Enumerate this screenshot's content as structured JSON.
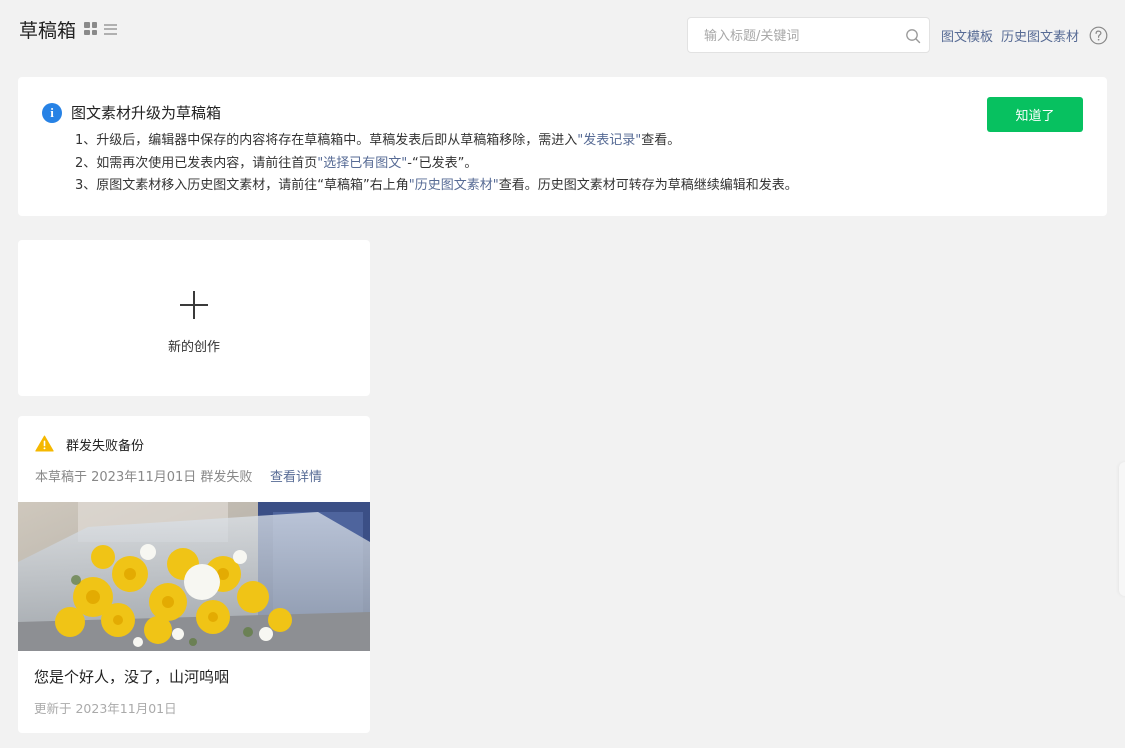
{
  "header": {
    "title": "草稿箱",
    "view_toggle": {
      "grid_icon": "grid-view-icon",
      "list_icon": "list-view-icon",
      "active": "grid"
    },
    "search": {
      "placeholder": "输入标题/关键词",
      "value": "",
      "icon": "search-icon"
    },
    "links": {
      "templates": "图文模板",
      "history": "历史图文素材"
    },
    "help_icon": "help-circle-icon"
  },
  "notice": {
    "icon": "info-icon",
    "title": "图文素材升级为草稿箱",
    "lines": [
      {
        "prefix": "1、升级后，编辑器中保存的内容将存在草稿箱中。草稿发表后即从草稿箱移除，需进入",
        "link": "\"发表记录\"",
        "suffix": "查看。"
      },
      {
        "prefix": "2、如需再次使用已发表内容，请前往首页",
        "link": "\"选择已有图文\"",
        "suffix": "-“已发表”。"
      },
      {
        "prefix": "3、原图文素材移入历史图文素材，请前往“草稿箱”右上角",
        "link": "\"历史图文素材\"",
        "suffix": "查看。历史图文素材可转存为草稿继续编辑和发表。"
      }
    ],
    "button_label": "知道了"
  },
  "new_card": {
    "icon": "plus-icon",
    "label": "新的创作"
  },
  "draft_card": {
    "warning": {
      "icon": "warning-icon",
      "title": "群发失败备份",
      "desc": "本草稿于 2023年11月01日 群发失败",
      "detail_link": "查看详情"
    },
    "cover": {
      "description": "yellow and white chrysanthemum bouquet"
    },
    "title": "您是个好人，没了，山河呜咽",
    "updated": "更新于 2023年11月01日"
  },
  "colors": {
    "background": "#f2f2f2",
    "card": "#ffffff",
    "link": "#576b95",
    "primary_button": "#07c160",
    "info_icon": "#2782e5",
    "warning_icon": "#f5b800"
  }
}
